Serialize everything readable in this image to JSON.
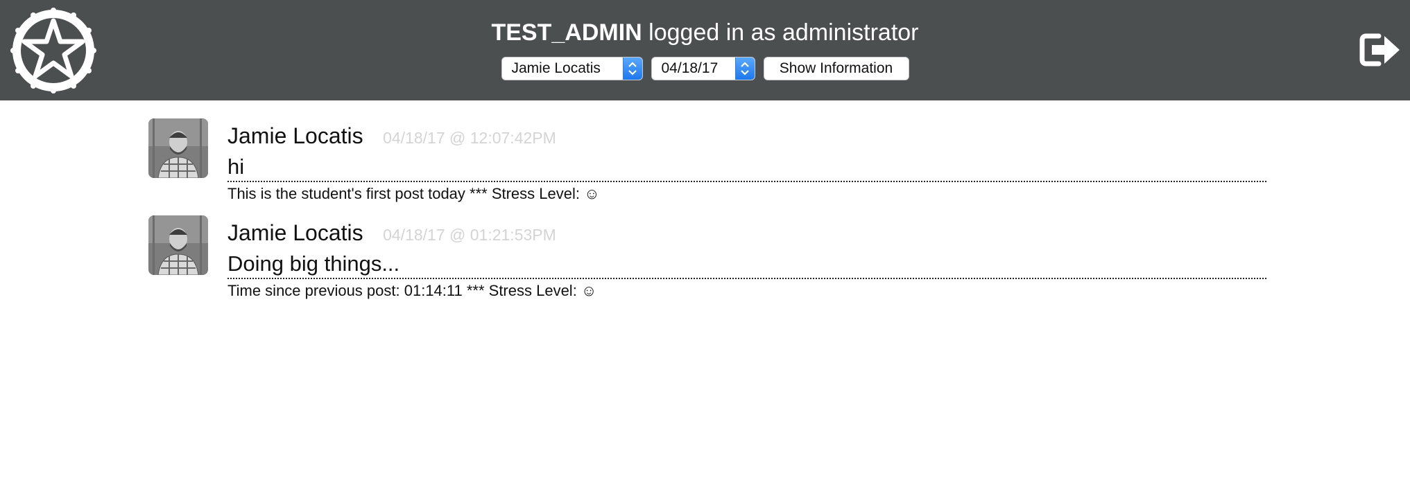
{
  "header": {
    "username": "TEST_ADMIN",
    "role_text": "logged in as administrator",
    "student_select": "Jamie Locatis",
    "date_select": "04/18/17",
    "show_button": "Show Information",
    "logo_icon": "star-badge-icon",
    "logout_icon": "logout-icon",
    "background_color": "#4b4f4f"
  },
  "posts": [
    {
      "author": "Jamie Locatis",
      "timestamp": "04/18/17 @ 12:07:42PM",
      "message": "hi",
      "meta": "This is the student's first post today *** Stress Level: ☺"
    },
    {
      "author": "Jamie Locatis",
      "timestamp": "04/18/17 @ 01:21:53PM",
      "message": "Doing big things...",
      "meta": "Time since previous post: 01:14:11 *** Stress Level: ☺"
    }
  ]
}
